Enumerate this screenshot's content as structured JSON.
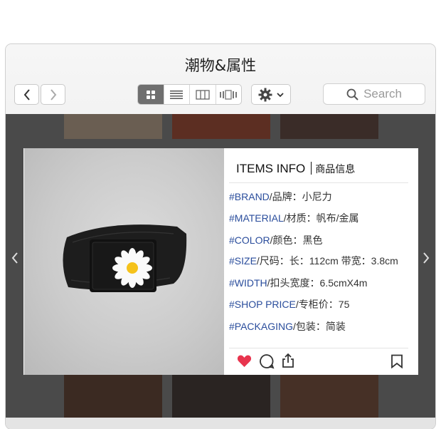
{
  "window": {
    "title": "潮物&属性"
  },
  "toolbar": {
    "back_icon": "chevron-left-icon",
    "forward_icon": "chevron-right-icon",
    "view_modes": [
      "grid-view-icon",
      "list-view-icon",
      "column-view-icon",
      "cover-flow-icon"
    ],
    "active_view": "grid-view-icon",
    "settings_icon": "gear-icon",
    "search_placeholder": "Search"
  },
  "product": {
    "header": "ITEMS INFO",
    "header_sub": "商品信息",
    "attributes": [
      {
        "key": "#BRAND",
        "value": "/品牌：小尼力"
      },
      {
        "key": "#MATERIAL",
        "value": "/材质：帆布/金属"
      },
      {
        "key": "#COLOR",
        "value": "/颜色：黑色"
      },
      {
        "key": "#SIZE",
        "value": "/尺码：长：112cm 带宽：3.8cm"
      },
      {
        "key": "#WIDTH",
        "value": "/扣头宽度：6.5cmX4m"
      },
      {
        "key": "#SHOP PRICE",
        "value": "/专柜价：75"
      },
      {
        "key": "#PACKAGING",
        "value": "/包装：简装"
      }
    ],
    "image_desc": "black belt daisy buckle",
    "actions": [
      "heart-icon",
      "comment-icon",
      "share-icon",
      "bookmark-icon"
    ]
  },
  "colors": {
    "accent": "#2a4d9c",
    "heart": "#e8344e",
    "active_seg": "#6f6f6f"
  }
}
